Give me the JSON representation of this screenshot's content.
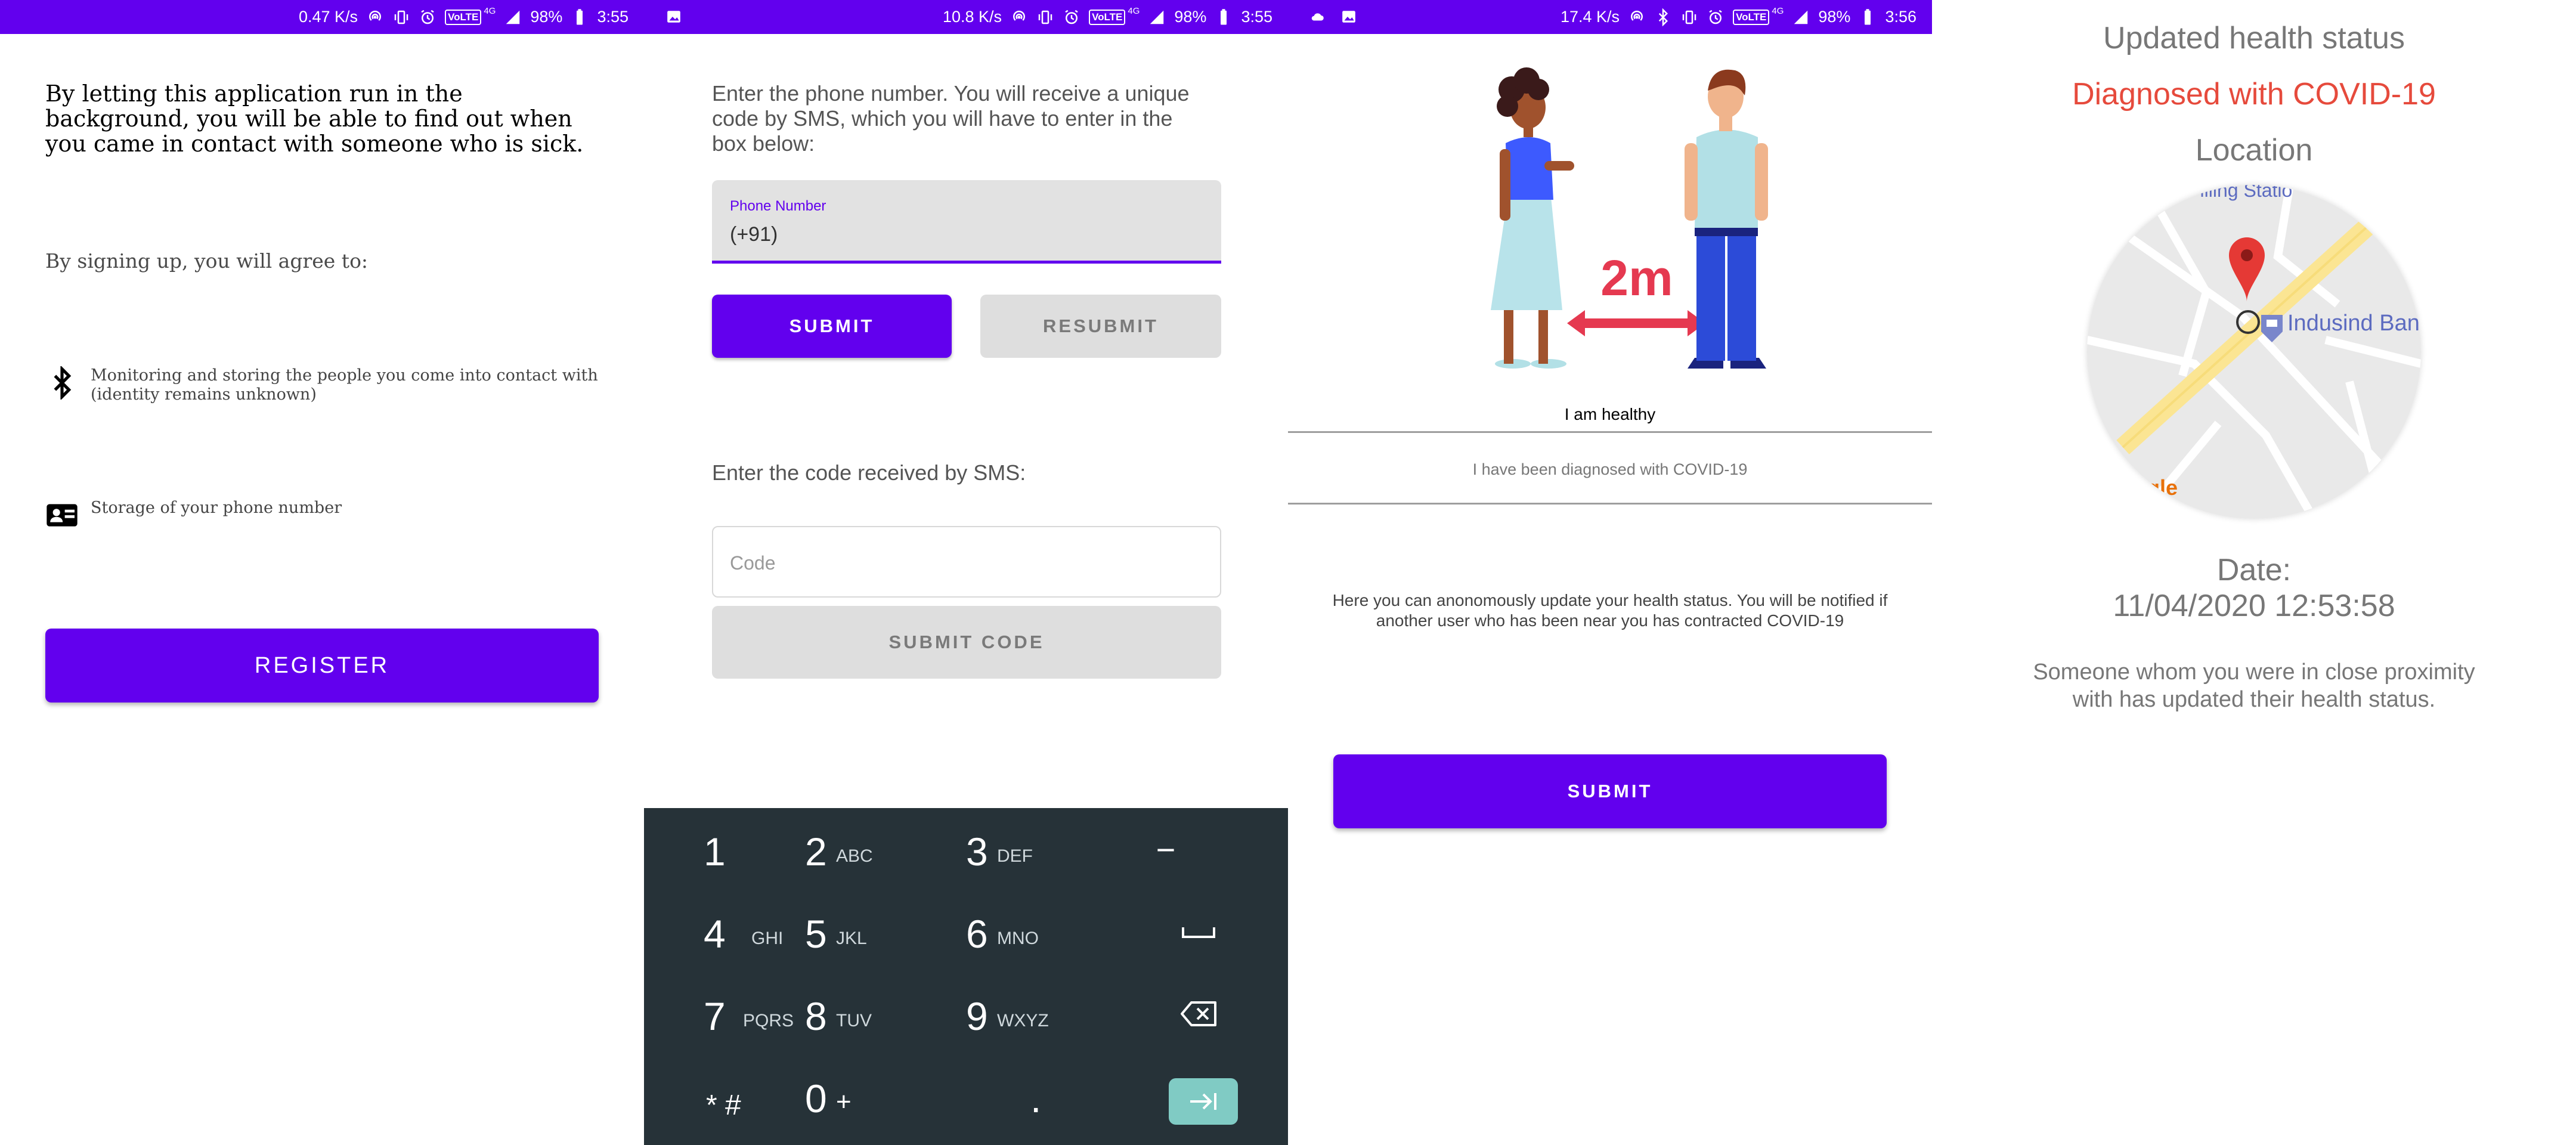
{
  "screens": [
    {
      "status": {
        "speed": "0.47 K/s",
        "battery": "98%",
        "time": "3:55",
        "volte": "VoLTE",
        "network": "4G"
      }
    },
    {
      "status": {
        "speed": "10.8 K/s",
        "battery": "98%",
        "time": "3:55",
        "volte": "VoLTE",
        "network": "4G"
      }
    },
    {
      "status": {
        "speed": "17.4 K/s",
        "battery": "98%",
        "time": "3:56",
        "volte": "VoLTE",
        "network": "4G"
      }
    }
  ],
  "register_screen": {
    "intro": "By letting this application run in the background, you will be able to find out when you came in contact with someone who is sick.",
    "agree_label": "By signing up, you will agree to:",
    "items": [
      {
        "icon": "bluetooth-icon",
        "text": "Monitoring and storing the people you come into contact with (identity remains unknown)"
      },
      {
        "icon": "contact-card-icon",
        "text": "Storage of your phone number"
      }
    ],
    "register_button": "REGISTER"
  },
  "verify_screen": {
    "instruction": "Enter the phone number. You will receive a unique code by SMS, which you will have to enter in the box below:",
    "phone_label": "Phone Number",
    "phone_value": "(+91)",
    "submit_button": "SUBMIT",
    "resubmit_button": "RESUBMIT",
    "code_label": "Enter the code received by SMS:",
    "code_placeholder": "Code",
    "submit_code_button": "SUBMIT CODE",
    "keypad": {
      "keys": [
        {
          "digit": "1",
          "letters": ""
        },
        {
          "digit": "2",
          "letters": "ABC"
        },
        {
          "digit": "3",
          "letters": "DEF"
        },
        {
          "digit": "4",
          "letters": "GHI"
        },
        {
          "digit": "5",
          "letters": "JKL"
        },
        {
          "digit": "6",
          "letters": "MNO"
        },
        {
          "digit": "7",
          "letters": "PQRS"
        },
        {
          "digit": "8",
          "letters": "TUV"
        },
        {
          "digit": "9",
          "letters": "WXYZ"
        },
        {
          "digit": "* #",
          "letters": ""
        },
        {
          "digit": "0",
          "letters": "+"
        },
        {
          "digit": ".",
          "letters": ""
        }
      ],
      "side_keys": [
        "−",
        "space",
        "backspace",
        "enter"
      ]
    }
  },
  "status_screen": {
    "illustration_label": "2m",
    "option_healthy": "I am healthy",
    "option_diagnosed": "I have been diagnosed with COVID-19",
    "help_text": "Here you can anonomously update your health status. You will be notified if another user who has been near you has contracted COVID-19",
    "submit_button": "SUBMIT"
  },
  "notification_screen": {
    "title": "Updated health status",
    "diagnosis": "Diagnosed with COVID-19",
    "location_label": "Location",
    "map": {
      "place_label": "Indusind Bank",
      "partial_label": "Filling Statio",
      "logo_partial": "gle",
      "pin_color": "#e53935"
    },
    "date_label": "Date:",
    "date_value": "11/04/2020 12:53:58",
    "note": "Someone whom you were in close proximity with has updated their health status."
  },
  "colors": {
    "primary": "#6200ee",
    "keypad_bg": "#263238",
    "accent_red": "#e64a3c",
    "enter_key": "#80cbc4"
  }
}
